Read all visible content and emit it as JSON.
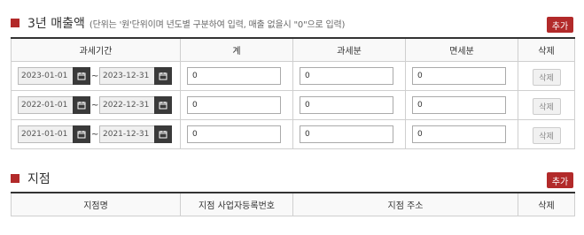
{
  "sales": {
    "title": "3년 매출액",
    "note": "(단위는 '원'단위이며 년도별 구분하여 입력, 매출 없을시 \"0\"으로 입력)",
    "add_label": "추가",
    "columns": [
      "과세기간",
      "계",
      "과세분",
      "면세분",
      "삭제"
    ],
    "period_separator": "~",
    "rows": [
      {
        "start": "2023-01-01",
        "end": "2023-12-31",
        "total": "0",
        "taxable": "0",
        "exempt": "0",
        "delete_label": "삭제"
      },
      {
        "start": "2022-01-01",
        "end": "2022-12-31",
        "total": "0",
        "taxable": "0",
        "exempt": "0",
        "delete_label": "삭제"
      },
      {
        "start": "2021-01-01",
        "end": "2021-12-31",
        "total": "0",
        "taxable": "0",
        "exempt": "0",
        "delete_label": "삭제"
      }
    ]
  },
  "branch": {
    "title": "지점",
    "add_label": "추가",
    "columns": [
      "지점명",
      "지점 사업자등록번호",
      "지점 주소",
      "삭제"
    ]
  },
  "colors": {
    "accent": "#b22a2a",
    "calendar_button": "#3a3a3a"
  },
  "icons": {
    "section_marker": "square-icon",
    "date_picker": "calendar-icon"
  }
}
